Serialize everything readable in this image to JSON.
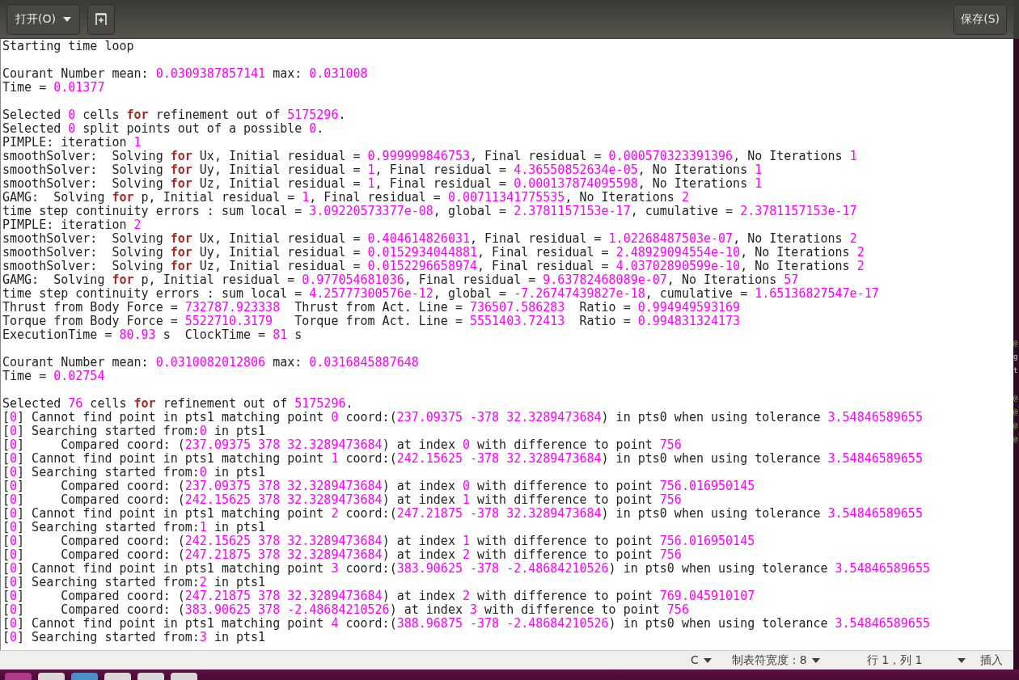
{
  "header": {
    "open_button": "打开(O)",
    "save_button": "保存(S)"
  },
  "editor": {
    "blocks": [
      [
        "Starting time loop"
      ],
      [
        "Courant Number mean: 0.0309387857141 max: 0.031008",
        "Time = 0.01377"
      ],
      [
        "Selected 0 cells **for** refinement out of 5175296.",
        "Selected 0 split points out of a possible 0.",
        "PIMPLE: iteration 1",
        "smoothSolver:  Solving **for** Ux, Initial residual = 0.999999846753, Final residual = 0.000570323391396, No Iterations 1",
        "smoothSolver:  Solving **for** Uy, Initial residual = 1, Final residual = 4.36550852634e-05, No Iterations 1",
        "smoothSolver:  Solving **for** Uz, Initial residual = 1, Final residual = 0.000137874095598, No Iterations 1",
        "GAMG:  Solving **for** p, Initial residual = 1, Final residual = 0.00711341775535, No Iterations 2",
        "time step continuity errors : sum local = 3.09220573377e-08, global = 2.3781157153e-17, cumulative = 2.3781157153e-17",
        "PIMPLE: iteration 2",
        "smoothSolver:  Solving **for** Ux, Initial residual = 0.404614826031, Final residual = 1.02268487503e-07, No Iterations 2",
        "smoothSolver:  Solving **for** Uy, Initial residual = 0.0152934044881, Final residual = 2.48929094554e-10, No Iterations 2",
        "smoothSolver:  Solving **for** Uz, Initial residual = 0.0152296658974, Final residual = 4.03702890599e-10, No Iterations 2",
        "GAMG:  Solving **for** p, Initial residual = 0.977054681036, Final residual = 9.63782468089e-07, No Iterations 57",
        "time step continuity errors : sum local = 4.25777300576e-12, global = -7.26747439827e-18, cumulative = 1.65136827547e-17",
        "Thrust from Body Force = 732787.923338  Thrust from Act. Line = 736507.586283  Ratio = 0.994949593169",
        "Torque from Body Force = 5522710.3179   Torque from Act. Line = 5551403.72413  Ratio = 0.994831324173",
        "ExecutionTime = 80.93 s  ClockTime = 81 s"
      ],
      [
        "Courant Number mean: 0.0310082012806 max: 0.0316845887648",
        "Time = 0.02754"
      ],
      [
        "Selected 76 cells **for** refinement out of 5175296.",
        "[0] Cannot find point in pts1 matching point 0 coord:(237.09375 -378 32.3289473684) in pts0 when using tolerance 3.54846589655",
        "[0] Searching started from:0 in pts1",
        "[0]     Compared coord: (237.09375 378 32.3289473684) at index 0 with difference to point 756",
        "[0] Cannot find point in pts1 matching point 1 coord:(242.15625 -378 32.3289473684) in pts0 when using tolerance 3.54846589655",
        "[0] Searching started from:0 in pts1",
        "[0]     Compared coord: (237.09375 378 32.3289473684) at index 0 with difference to point 756.016950145",
        "[0]     Compared coord: (242.15625 378 32.3289473684) at index 1 with difference to point 756",
        "[0] Cannot find point in pts1 matching point 2 coord:(247.21875 -378 32.3289473684) in pts0 when using tolerance 3.54846589655",
        "[0] Searching started from:1 in pts1",
        "[0]     Compared coord: (242.15625 378 32.3289473684) at index 1 with difference to point 756.016950145",
        "[0]     Compared coord: (247.21875 378 32.3289473684) at index 2 with difference to point 756",
        "[0] Cannot find point in pts1 matching point 3 coord:(383.90625 -378 -2.48684210526) in pts0 when using tolerance 3.54846589655",
        "[0] Searching started from:2 in pts1",
        "[0]     Compared coord: (247.21875 378 32.3289473684) at index 2 with difference to point 769.045910107",
        "[0]     Compared coord: (383.90625 378 -2.48684210526) at index 3 with difference to point 756",
        "[0] Cannot find point in pts1 matching point 4 coord:(388.96875 -378 -2.48684210526) in pts0 when using tolerance 3.54846589655",
        "[0] Searching started from:3 in pts1"
      ]
    ]
  },
  "status_bar": {
    "language": "C",
    "tab_width": "制表符宽度：8",
    "position": "行 1，列 1",
    "mode": "插入"
  },
  "background_window": {
    "glyphs": [
      "@",
      "g",
      "t",
      "@",
      "@",
      "@",
      "@"
    ]
  }
}
